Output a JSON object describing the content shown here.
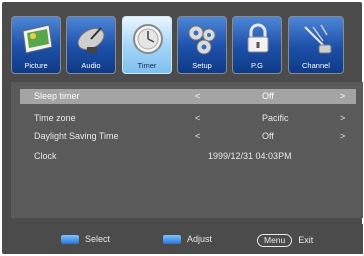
{
  "tabs": [
    {
      "label": "Picture",
      "icon": "picture-icon"
    },
    {
      "label": "Audio",
      "icon": "satellite-dish-icon"
    },
    {
      "label": "Timer",
      "icon": "clock-icon",
      "active": true
    },
    {
      "label": "Setup",
      "icon": "gears-icon"
    },
    {
      "label": "P.G",
      "icon": "lock-icon"
    },
    {
      "label": "Channel",
      "icon": "antenna-icon"
    }
  ],
  "rows": [
    {
      "label": "Sleep timer",
      "left_arrow": "<",
      "value": "Off",
      "right_arrow": ">",
      "selected": true
    },
    {
      "label": "Time zone",
      "left_arrow": "<",
      "value": "Pacific",
      "right_arrow": ">"
    },
    {
      "label": "Daylight Saving Time",
      "left_arrow": "<",
      "value": "Off",
      "right_arrow": ">"
    },
    {
      "label": "Clock",
      "value": "1999/12/31 04:03PM"
    }
  ],
  "footer": {
    "select": "Select",
    "adjust": "Adjust",
    "menu_key": "Menu",
    "exit": "Exit"
  },
  "colors": {
    "background": "#4b4b4b",
    "panel": "#5a5a5a",
    "selected_row": "#a4a4a4",
    "tab_blue": "#1c4fa8",
    "tab_active": "#a6d6f8"
  }
}
